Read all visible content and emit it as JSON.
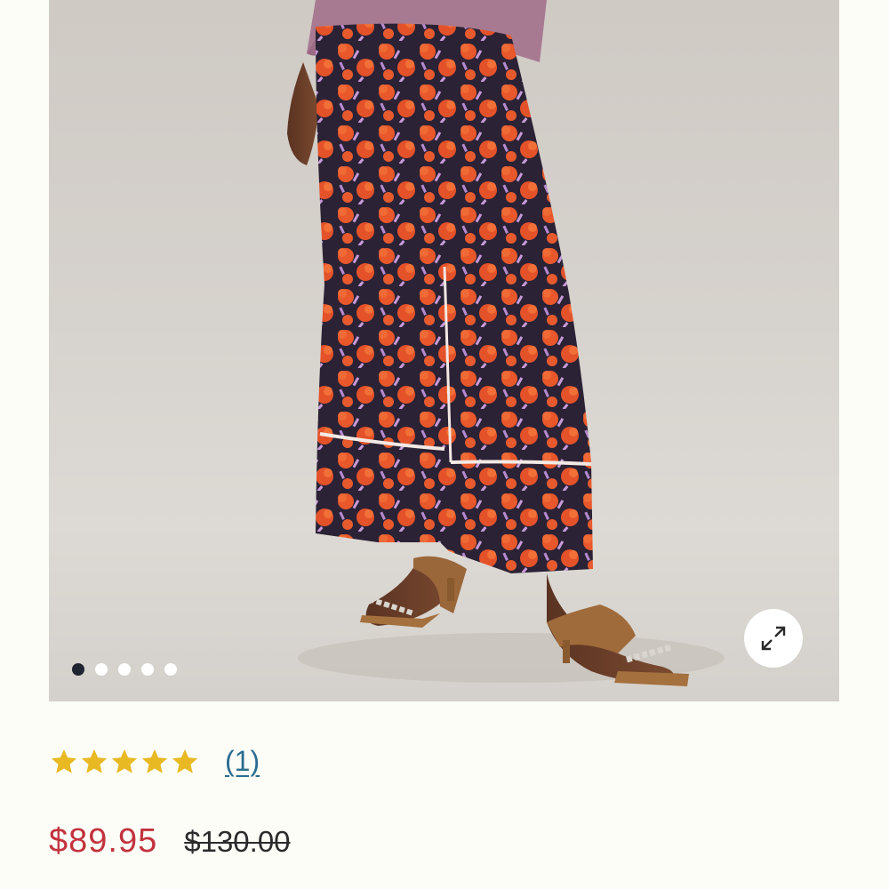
{
  "product": {
    "image_alt": "Model wearing wide-leg floral print pants with chain-strap sandals",
    "gallery": {
      "slide_count": 5,
      "active_index": 0,
      "expand_icon": "expand-arrows-icon"
    },
    "rating": {
      "stars": 5,
      "star_color": "#e8b923",
      "review_count": "(1)",
      "link_color": "#2a6c8f"
    },
    "price": {
      "sale": "$89.95",
      "original": "$130.00",
      "sale_color": "#c2333d"
    }
  }
}
